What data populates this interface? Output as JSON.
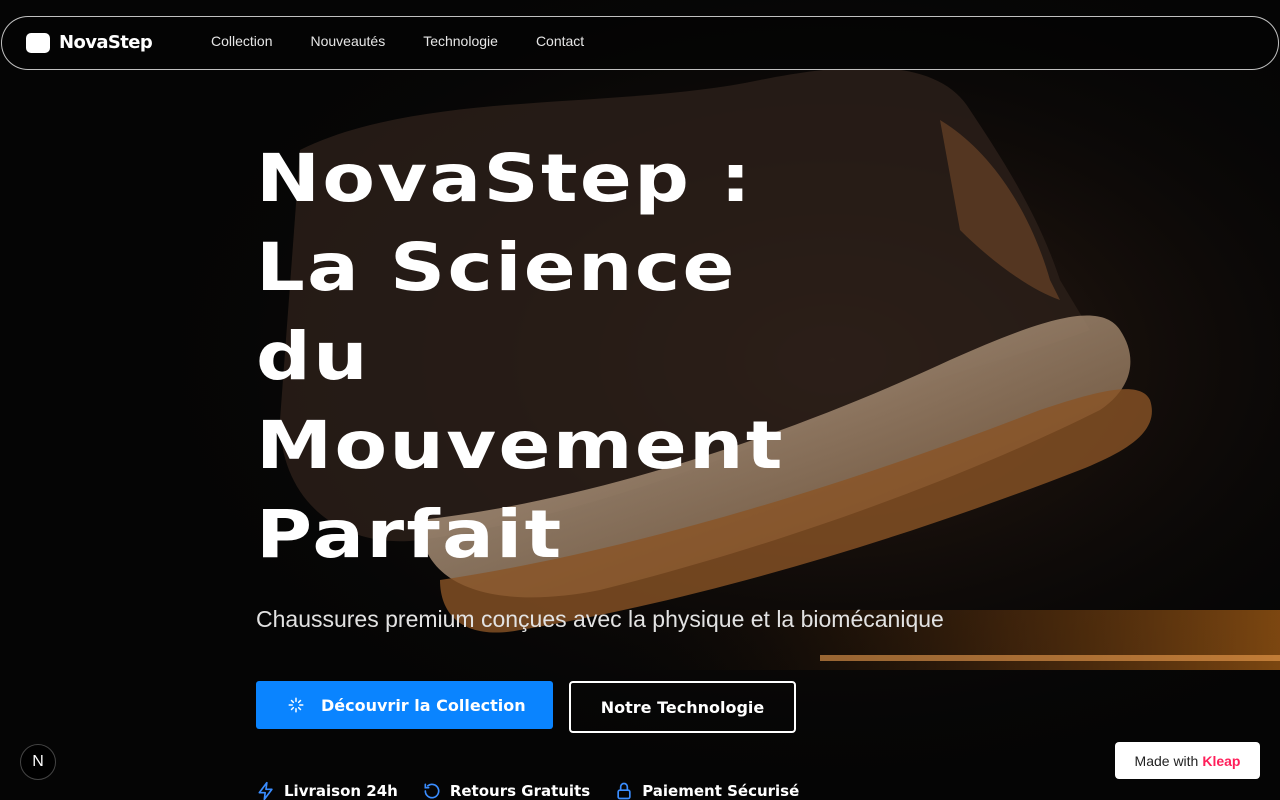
{
  "nav": {
    "brand": "NovaStep",
    "links": [
      "Collection",
      "Nouveautés",
      "Technologie",
      "Contact"
    ]
  },
  "hero": {
    "headline_lines": [
      "NovaStep :",
      "La Science",
      "du",
      "Mouvement",
      "Parfait"
    ],
    "subtitle": "Chaussures premium conçues avec la physique et la biomécanique",
    "primary_button": "Découvrir la Collection",
    "secondary_button": "Notre Technologie"
  },
  "features": [
    {
      "icon": "lightning-icon",
      "label": "Livraison 24h"
    },
    {
      "icon": "refresh-icon",
      "label": "Retours Gratuits"
    },
    {
      "icon": "lock-icon",
      "label": "Paiement Sécurisé"
    }
  ],
  "widgets": {
    "next_badge": "N",
    "made_with_prefix": "Made with",
    "made_with_brand": "Kleap"
  },
  "colors": {
    "background": "#050505",
    "accent": "#0a84ff",
    "made_with_brand": "#ff1f5a"
  }
}
